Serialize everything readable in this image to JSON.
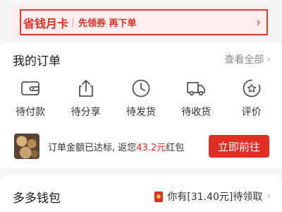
{
  "promo": {
    "title": "省钱月卡",
    "subtitle": "先领券 再下单",
    "arrow": "›"
  },
  "orders": {
    "title": "我的订单",
    "view_all": "查看全部",
    "chevron": "›",
    "tabs": [
      {
        "label": "待付款",
        "icon": "wallet-icon"
      },
      {
        "label": "待分享",
        "icon": "share-icon"
      },
      {
        "label": "待发货",
        "icon": "clock-icon"
      },
      {
        "label": "待收货",
        "icon": "truck-icon"
      },
      {
        "label": "评价",
        "icon": "review-icon"
      }
    ]
  },
  "reward": {
    "text_prefix": "订单金额已达标, 返您",
    "amount": "43.2元",
    "text_suffix": "红包",
    "button": "立即前往"
  },
  "wallet": {
    "title": "多多钱包",
    "claim_text": "你有[31.40元]待领取",
    "chevron": "›"
  },
  "colors": {
    "brand_red": "#e02e24",
    "promo_bg": "#fdeeee",
    "page_bg": "#f4f4f4"
  }
}
